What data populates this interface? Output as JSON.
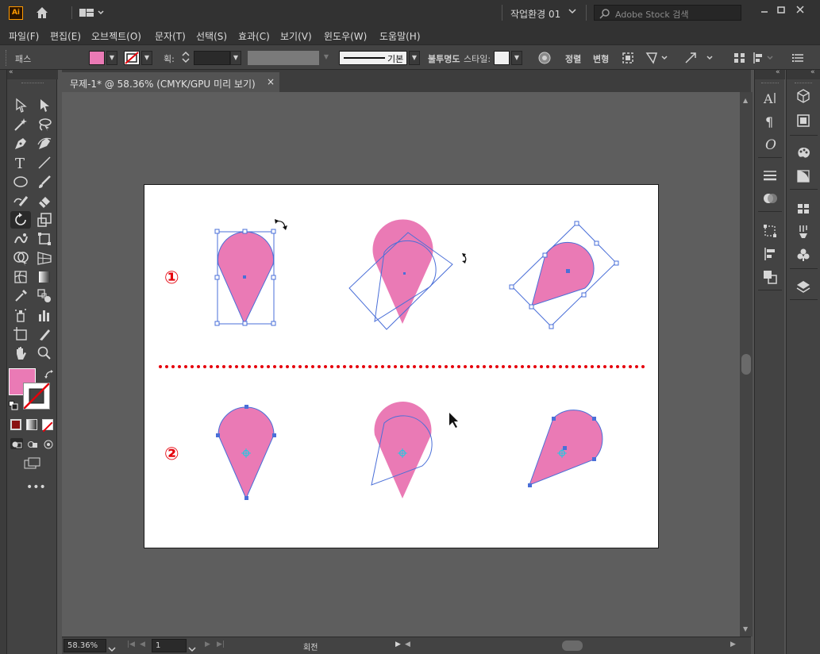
{
  "app": {
    "logo": "Ai",
    "workspace": "작업환경 01",
    "search_placeholder": "Adobe Stock 검색"
  },
  "menu": [
    "파일(F)",
    "편집(E)",
    "오브젝트(O)",
    "문자(T)",
    "선택(S)",
    "효과(C)",
    "보기(V)",
    "윈도우(W)",
    "도움말(H)"
  ],
  "control": {
    "selection_label": "패스",
    "stroke_label": "획:",
    "stroke_style": "기본",
    "opacity_label": "불투명도",
    "style_label": "스타일:",
    "align_label": "정렬",
    "transform_label": "변형",
    "fill_color": "#ea7ab5"
  },
  "document": {
    "tab_title": "무제-1* @ 58.36% (CMYK/GPU 미리 보기)",
    "close_glyph": "×"
  },
  "artboard": {
    "step1_label": "①",
    "step2_label": "②",
    "shape_color": "#ea7ab5",
    "guide_color": "#4a6fd8",
    "divider_color": "#e5000b"
  },
  "status": {
    "zoom": "58.36%",
    "page": "1",
    "tool_name": "회전"
  },
  "icons": {
    "left_tools": [
      "selection-icon",
      "direct-selection-icon",
      "magic-wand-icon",
      "lasso-icon",
      "pen-icon",
      "curvature-icon",
      "type-icon",
      "line-icon",
      "ellipse-icon",
      "paintbrush-icon",
      "shaper-icon",
      "eraser-icon",
      "rotate-icon",
      "scale-icon",
      "warp-icon",
      "free-transform-icon",
      "shape-builder-icon",
      "perspective-icon",
      "mesh-icon",
      "gradient-icon",
      "eyedropper-icon",
      "blend-icon",
      "symbol-sprayer-icon",
      "column-graph-icon",
      "artboard-icon",
      "slice-icon",
      "hand-icon",
      "zoom-icon"
    ],
    "right_panel_a": [
      "character-icon",
      "paragraph-icon",
      "opentype-icon",
      "stroke-icon",
      "transparency-icon",
      "transform-icon",
      "align-icon",
      "pathfinder-icon"
    ],
    "right_panel_b": [
      "libraries-icon",
      "properties-icon",
      "color-icon",
      "color-guide-icon",
      "swatches-icon",
      "brushes-icon",
      "symbols-icon",
      "layers-icon"
    ]
  }
}
